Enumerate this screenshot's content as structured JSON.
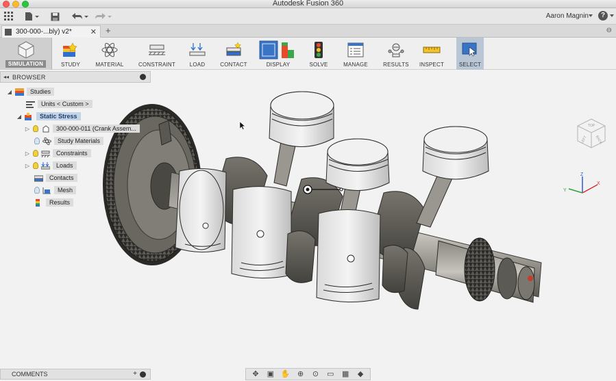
{
  "window": {
    "title": "Autodesk Fusion 360"
  },
  "appbar": {
    "user": "Aaron Magnin",
    "help": "?"
  },
  "tabs": [
    {
      "label": "300-000-...bly) v2*"
    }
  ],
  "ribbon": {
    "workspace": "SIMULATION",
    "items": [
      {
        "label": "STUDY"
      },
      {
        "label": "MATERIAL"
      },
      {
        "label": "CONSTRAINT"
      },
      {
        "label": "LOAD"
      },
      {
        "label": "CONTACT"
      },
      {
        "label": "DISPLAY"
      },
      {
        "label": "SOLVE"
      },
      {
        "label": "MANAGE"
      },
      {
        "label": "RESULTS"
      },
      {
        "label": "INSPECT"
      },
      {
        "label": "SELECT"
      }
    ]
  },
  "browser": {
    "title": "BROWSER",
    "root": "Studies",
    "units": "Units < Custom >",
    "study": "Static Stress",
    "nodes": [
      {
        "label": "300-000-011 (Crank Assem..."
      },
      {
        "label": "Study Materials"
      },
      {
        "label": "Constraints"
      },
      {
        "label": "Loads"
      },
      {
        "label": "Contacts"
      },
      {
        "label": "Mesh"
      },
      {
        "label": "Results"
      }
    ]
  },
  "viewcube": {
    "face_top": "TOP",
    "face_front": "LEFT",
    "face_side": "BACK"
  },
  "triad": {
    "z": "Z",
    "x": "X",
    "y": "Y"
  },
  "comments": {
    "title": "COMMENTS"
  },
  "colors": {
    "accent": "#3a74c4",
    "select_bg": "#b9c6d6"
  }
}
